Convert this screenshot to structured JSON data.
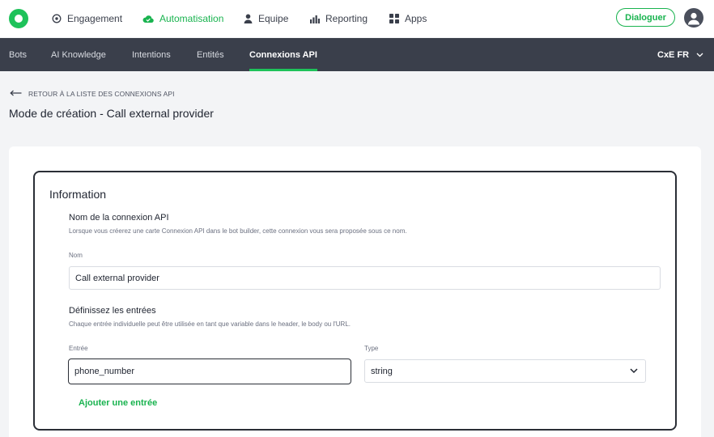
{
  "topnav": {
    "items": [
      {
        "label": "Engagement",
        "icon": "target-icon"
      },
      {
        "label": "Automatisation",
        "icon": "cloud-icon",
        "active": true
      },
      {
        "label": "Equipe",
        "icon": "person-icon"
      },
      {
        "label": "Reporting",
        "icon": "bar-chart-icon"
      },
      {
        "label": "Apps",
        "icon": "grid-icon"
      }
    ],
    "dialoguer_label": "Dialoguer",
    "accent_color": "#19b34f"
  },
  "subnav": {
    "items": [
      {
        "label": "Bots"
      },
      {
        "label": "AI Knowledge"
      },
      {
        "label": "Intentions"
      },
      {
        "label": "Entités"
      },
      {
        "label": "Connexions API",
        "active": true
      }
    ],
    "workspace_label": "CxE FR"
  },
  "breadcrumb": {
    "back_label": "RETOUR À LA LISTE DES CONNEXIONS API"
  },
  "page": {
    "title": "Mode de création - Call external provider"
  },
  "form": {
    "section_title": "Information",
    "name_section": {
      "title": "Nom de la connexion API",
      "help": "Lorsque vous créerez une carte Connexion API dans le bot builder, cette connexion vous sera proposée sous ce nom.",
      "field_label": "Nom",
      "value": "Call external provider"
    },
    "inputs_section": {
      "title": "Définissez les entrées",
      "help": "Chaque entrée individuelle peut être utilisée en tant que variable dans le header, le body ou l'URL.",
      "entry_label": "Entrée",
      "entry_value": "phone_number",
      "type_label": "Type",
      "type_value": "string",
      "add_label": "Ajouter une entrée"
    }
  }
}
